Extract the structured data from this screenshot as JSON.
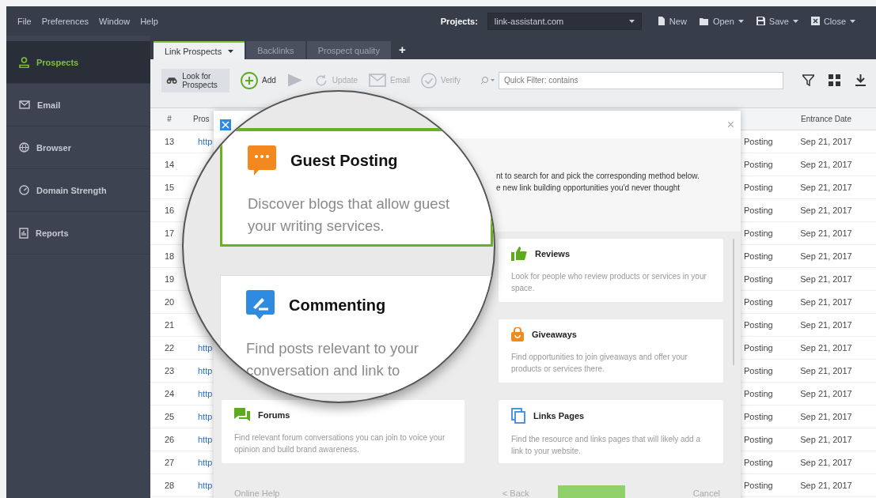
{
  "menubar": {
    "menus": [
      "File",
      "Preferences",
      "Window",
      "Help"
    ],
    "projects_label": "Projects:",
    "project": "link-assistant.com",
    "actions": [
      {
        "label": "New",
        "dropdown": false
      },
      {
        "label": "Open",
        "dropdown": true
      },
      {
        "label": "Save",
        "dropdown": true
      },
      {
        "label": "Close",
        "dropdown": true
      }
    ]
  },
  "sidebar": {
    "items": [
      {
        "label": "Prospects",
        "selected": true
      },
      {
        "label": "Email",
        "selected": false
      },
      {
        "label": "Browser",
        "selected": false
      },
      {
        "label": "Domain Strength",
        "selected": false
      },
      {
        "label": "Reports",
        "selected": false
      }
    ]
  },
  "tabs": [
    {
      "label": "Link Prospects",
      "selected": true,
      "dropdown": true
    },
    {
      "label": "Backlinks",
      "selected": false,
      "dropdown": false
    },
    {
      "label": "Prospect quality",
      "selected": false,
      "dropdown": false
    }
  ],
  "add_tab": "+",
  "toolbar": {
    "buttons": [
      {
        "kind": "big",
        "label": "Look for Prospects",
        "disabled": false
      },
      {
        "kind": "icon",
        "label": "Add",
        "disabled": false
      },
      {
        "kind": "icon",
        "disabled": true
      },
      {
        "kind": "icon",
        "label": "Update",
        "disabled": true
      },
      {
        "kind": "icon",
        "label": "Email",
        "disabled": true
      },
      {
        "kind": "icon",
        "label": "Verify",
        "disabled": true
      }
    ],
    "search_placeholder": "Quick Filter: contains"
  },
  "table": {
    "headers": {
      "number": "#",
      "prospect": "Pros",
      "date": "Entrance Date"
    },
    "rows": [
      {
        "n": "13",
        "prospect": "http",
        "type": "Posting",
        "date": "Sep 21, 2017"
      },
      {
        "n": "14",
        "type": "Posting",
        "date": "Sep 21, 2017"
      },
      {
        "n": "15",
        "type": "Posting",
        "date": "Sep 21, 2017"
      },
      {
        "n": "16",
        "type": "Posting",
        "date": "Sep 21, 2017"
      },
      {
        "n": "17",
        "type": "Posting",
        "date": "Sep 21, 2017"
      },
      {
        "n": "18",
        "type": "Posting",
        "date": "Sep 21, 2017"
      },
      {
        "n": "19",
        "type": "Posting",
        "date": "Sep 21, 2017"
      },
      {
        "n": "20",
        "type": "Posting",
        "date": "Sep 21, 2017"
      },
      {
        "n": "21",
        "type": "Posting",
        "date": "Sep 21, 2017"
      },
      {
        "n": "22",
        "prospect": "http",
        "type": "Posting",
        "date": "Sep 21, 2017"
      },
      {
        "n": "23",
        "prospect": "http",
        "type": "Posting",
        "date": "Sep 21, 2017"
      },
      {
        "n": "24",
        "prospect": "http",
        "type": "Posting",
        "date": "Sep 21, 2017"
      },
      {
        "n": "25",
        "prospect": "http",
        "type": "Posting",
        "date": "Sep 21, 2017"
      },
      {
        "n": "26",
        "prospect": "http",
        "type": "Posting",
        "date": "Sep 21, 2017"
      },
      {
        "n": "27",
        "prospect": "http",
        "type": "Posting",
        "date": "Sep 21, 2017"
      },
      {
        "n": "28",
        "prospect": "http",
        "type": "Posting",
        "date": "Sep 21, 2017"
      }
    ]
  },
  "dialog": {
    "close": "×",
    "intro": [
      "nt to search for and pick the corresponding method below.",
      "e new link building opportunities you'd never thought"
    ],
    "cards": [
      {
        "title": "Forums",
        "description": "Find relevant forum conversations you can join to voice your opinion and build brand awareness."
      },
      {
        "title": "Reviews",
        "description": "Look for people who review products or services in your space."
      },
      {
        "title": "Giveaways",
        "description": "Find opportunities to join giveaways and offer your products or services there."
      },
      {
        "title": "Links Pages",
        "description": "Find the resource and links pages that will likely add a link to your website."
      }
    ],
    "footer": {
      "help": "Online Help",
      "back": "< Back",
      "cancel": "Cancel"
    }
  },
  "magnifier": {
    "cards": [
      {
        "title": "Guest Posting",
        "selected": true,
        "lines": [
          "Discover blogs that allow guest",
          "your writing services."
        ]
      },
      {
        "title": "Commenting",
        "selected": false,
        "lines": [
          "Find posts relevant to your",
          "conversation and link to"
        ]
      }
    ]
  }
}
